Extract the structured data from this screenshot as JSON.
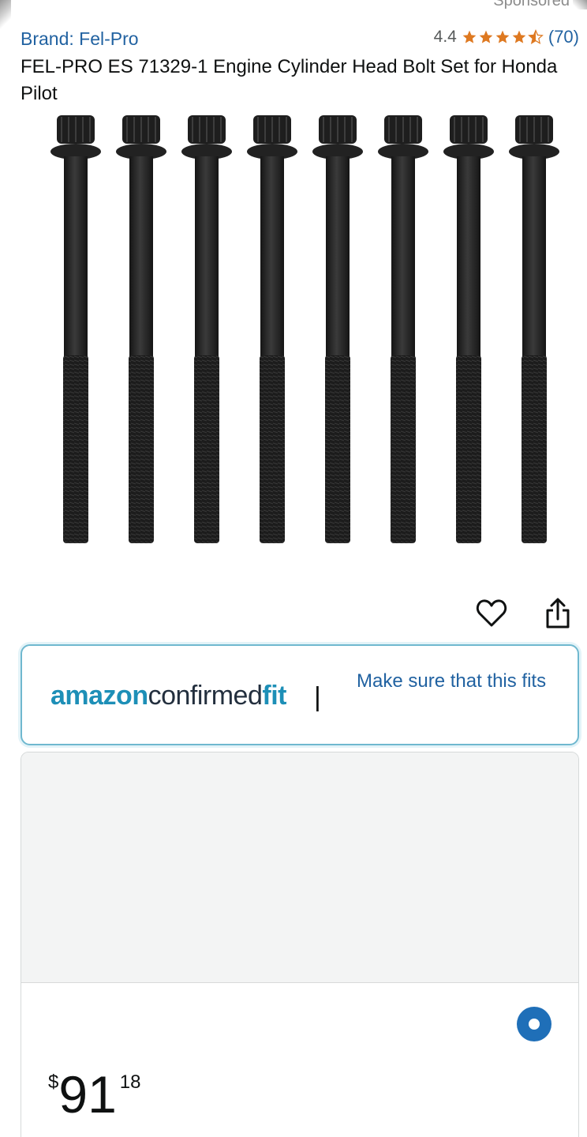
{
  "header": {
    "sponsored_label": "Sponsored",
    "brand": "Brand: Fel-Pro",
    "rating_value": "4.4",
    "rating_stars": 4.4,
    "review_count": "(70)",
    "star_color": "#de7921"
  },
  "product": {
    "title": "FEL-PRO ES 71329-1 Engine Cylinder Head Bolt Set for Honda Pilot",
    "image_icon": "bolt-set-product-image",
    "bolt_count": 8
  },
  "actions": {
    "wishlist_icon": "heart-icon",
    "share_icon": "share-icon"
  },
  "fit_banner": {
    "logo_amazon": "amazon",
    "logo_confirmed": "confirmed",
    "logo_fit": "fit",
    "divider": "|",
    "cta": "Make sure that this fits"
  },
  "vehicle_option": {
    "selected": true,
    "price_symbol": "$",
    "price_whole": "91",
    "price_fraction": "18"
  }
}
